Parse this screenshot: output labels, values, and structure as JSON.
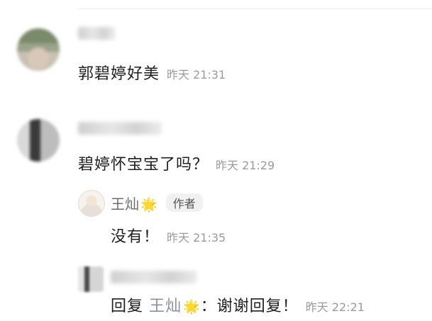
{
  "comments": [
    {
      "text": "郭碧婷好美",
      "time": "昨天 21:31"
    },
    {
      "text": "碧婷怀宝宝了吗？",
      "time": "昨天 21:29",
      "author_reply": {
        "name": "王灿",
        "badge": "作者",
        "text": "没有！",
        "time": "昨天 21:35"
      }
    },
    {
      "reply_prefix": "回复",
      "reply_to": "王灿",
      "colon": "：",
      "text": "谢谢回复！",
      "time": "昨天 22:21"
    }
  ],
  "icons": {
    "star": "star-icon",
    "star_glyph": "🌟"
  }
}
